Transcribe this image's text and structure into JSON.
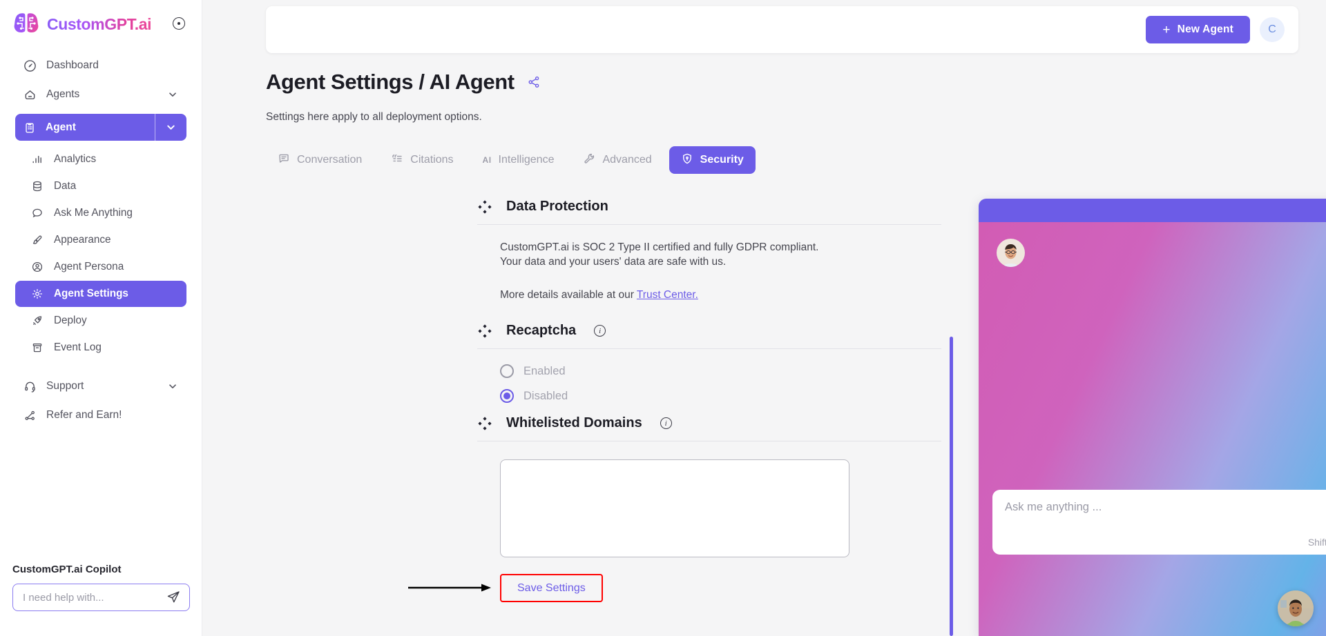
{
  "brand": {
    "name": "CustomGPT.ai",
    "toggle_icon": "collapse-toggle-icon"
  },
  "sidebar": {
    "top_items": [
      {
        "label": "Dashboard",
        "icon": "dashboard-icon"
      },
      {
        "label": "Agents",
        "icon": "home-icon",
        "chevron": "chevron-down-icon"
      }
    ],
    "active_group": {
      "label": "Agent",
      "icon": "clipboard-icon",
      "chevron": "chevron-down-icon"
    },
    "sub_items": [
      {
        "label": "Analytics",
        "icon": "bar-chart-icon",
        "active": false
      },
      {
        "label": "Data",
        "icon": "database-icon",
        "active": false
      },
      {
        "label": "Ask Me Anything",
        "icon": "chat-bubble-icon",
        "active": false
      },
      {
        "label": "Appearance",
        "icon": "paintbrush-icon",
        "active": false
      },
      {
        "label": "Agent Persona",
        "icon": "user-circle-icon",
        "active": false
      },
      {
        "label": "Agent Settings",
        "icon": "gear-icon",
        "active": true
      },
      {
        "label": "Deploy",
        "icon": "rocket-icon",
        "active": false
      },
      {
        "label": "Event Log",
        "icon": "archive-icon",
        "active": false
      }
    ],
    "bottom_items": [
      {
        "label": "Support",
        "icon": "headset-icon",
        "chevron": "chevron-down-icon"
      },
      {
        "label": "Refer and Earn!",
        "icon": "share-nodes-icon"
      }
    ],
    "copilot": {
      "title": "CustomGPT.ai Copilot",
      "placeholder": "I need help with...",
      "value": "",
      "send_icon": "paper-plane-icon"
    }
  },
  "topbar": {
    "new_agent_label": "New Agent",
    "new_agent_plus": "+",
    "avatar_initial": "C"
  },
  "page": {
    "title": "Agent Settings / AI Agent",
    "share_icon": "share-icon",
    "subtitle": "Settings here apply to all deployment options."
  },
  "tabs": [
    {
      "label": "Conversation",
      "icon": "message-square-icon",
      "active": false
    },
    {
      "label": "Citations",
      "icon": "quote-list-icon",
      "active": false
    },
    {
      "label": "Intelligence",
      "icon": "ai-text-icon",
      "active": false
    },
    {
      "label": "Advanced",
      "icon": "wrench-icon",
      "active": false
    },
    {
      "label": "Security",
      "icon": "shield-check-icon",
      "active": true
    }
  ],
  "sections": {
    "data_protection": {
      "title": "Data Protection",
      "icon": "diamonds-icon",
      "line1": "CustomGPT.ai is SOC 2 Type II certified and fully GDPR compliant.",
      "line2": "Your data and your users' data are safe with us.",
      "more_prefix": "More details available at our ",
      "link_text": "Trust Center."
    },
    "recaptcha": {
      "title": "Recaptcha",
      "icon": "diamonds-icon",
      "info_icon": "info-icon",
      "options": [
        {
          "label": "Enabled",
          "selected": false
        },
        {
          "label": "Disabled",
          "selected": true
        }
      ]
    },
    "whitelisted_domains": {
      "title": "Whitelisted Domains",
      "icon": "diamonds-icon",
      "info_icon": "info-icon",
      "textarea_value": "",
      "save_label": "Save Settings"
    }
  },
  "annotations": {
    "arrow_color": "#000000",
    "highlight_box_color": "#ff0000",
    "target": "Save Settings"
  },
  "chat_widget": {
    "close_icon": "close-icon",
    "avatar_icon": "agent-avatar",
    "input_placeholder": "Ask me anything ...",
    "input_value": "",
    "hint": "Shift + Enter to add a new line",
    "send_icon": "paper-plane-icon"
  },
  "float_button": {
    "icon": "chat-launcher-avatar"
  },
  "colors": {
    "accent": "#6c5ce7",
    "page_bg": "#f5f5f6",
    "muted_text": "#9d9da9",
    "link": "#6c5ce7"
  }
}
